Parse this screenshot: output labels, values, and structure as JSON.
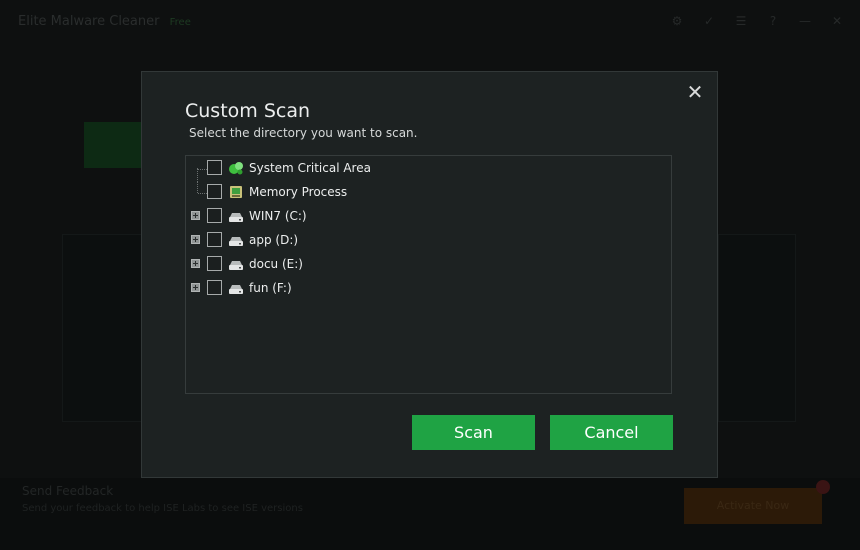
{
  "app": {
    "title": "Elite Malware Cleaner",
    "version_badge": "Free",
    "controls": [
      "⚙",
      "✓",
      "☰",
      "?",
      "—",
      "✕"
    ],
    "footer_title": "Send Feedback",
    "footer_sub": "Send your feedback to help ISE Labs to see ISE versions",
    "footer_button": "Activate Now"
  },
  "dialog": {
    "title": "Custom Scan",
    "subtitle": "Select the directory you want to scan.",
    "close_label": "✕",
    "items": [
      {
        "label": "System Critical Area",
        "icon": "system-area-icon",
        "expandable": false,
        "checked": false
      },
      {
        "label": "Memory Process",
        "icon": "memory-process-icon",
        "expandable": false,
        "checked": false
      },
      {
        "label": "WIN7 (C:)",
        "icon": "drive-icon",
        "expandable": true,
        "checked": false
      },
      {
        "label": "app (D:)",
        "icon": "drive-icon",
        "expandable": true,
        "checked": false
      },
      {
        "label": "docu (E:)",
        "icon": "drive-icon",
        "expandable": true,
        "checked": false
      },
      {
        "label": "fun (F:)",
        "icon": "drive-icon",
        "expandable": true,
        "checked": false
      }
    ],
    "scan_label": "Scan",
    "cancel_label": "Cancel"
  },
  "colors": {
    "accent_green": "#1fa344",
    "dialog_bg": "#1d2222"
  }
}
